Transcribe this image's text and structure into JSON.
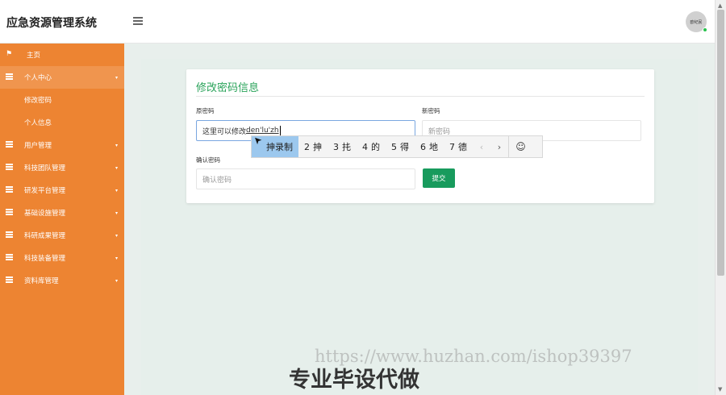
{
  "header": {
    "app_title": "应急资源管理系统",
    "avatar_text": "欧纪民"
  },
  "sidebar": {
    "items": [
      {
        "label": "主页",
        "icon": "flag-icon"
      },
      {
        "label": "个人中心",
        "icon": "grid-icon",
        "expanded": true,
        "children": [
          {
            "label": "修改密码"
          },
          {
            "label": "个人信息"
          }
        ]
      },
      {
        "label": "用户管理",
        "icon": "grid-icon"
      },
      {
        "label": "科技团队管理",
        "icon": "grid-icon"
      },
      {
        "label": "研发平台管理",
        "icon": "grid-icon"
      },
      {
        "label": "基础设施管理",
        "icon": "grid-icon"
      },
      {
        "label": "科研成果管理",
        "icon": "grid-icon"
      },
      {
        "label": "科技装备管理",
        "icon": "grid-icon"
      },
      {
        "label": "资料库管理",
        "icon": "grid-icon"
      }
    ],
    "arrow_glyph": "▾"
  },
  "form": {
    "title": "修改密码信息",
    "old_password_label": "原密码",
    "old_password_value_prefix": "这里可以修改",
    "old_password_value_composing": "den'lu'zh",
    "new_password_label": "新密码",
    "new_password_placeholder": "新密码",
    "confirm_password_label": "确认密码",
    "confirm_password_placeholder": "确认密码",
    "submit_label": "提交"
  },
  "ime": {
    "candidates": [
      {
        "num": "",
        "text": "抻录制"
      },
      {
        "num": "2",
        "text": "抻"
      },
      {
        "num": "3",
        "text": "扥"
      },
      {
        "num": "4",
        "text": "的"
      },
      {
        "num": "5",
        "text": "得"
      },
      {
        "num": "6",
        "text": "地"
      },
      {
        "num": "7",
        "text": "德"
      }
    ],
    "prev_glyph": "‹",
    "next_glyph": "›",
    "emoji_glyph": "☺"
  },
  "watermark": {
    "url": "https://www.huzhan.com/ishop39397",
    "text": "专业毕设代做"
  },
  "colors": {
    "sidebar_bg": "#ed8432",
    "sidebar_active": "#f0954e",
    "accent_green": "#2aa35a",
    "button_green": "#189b5d"
  }
}
